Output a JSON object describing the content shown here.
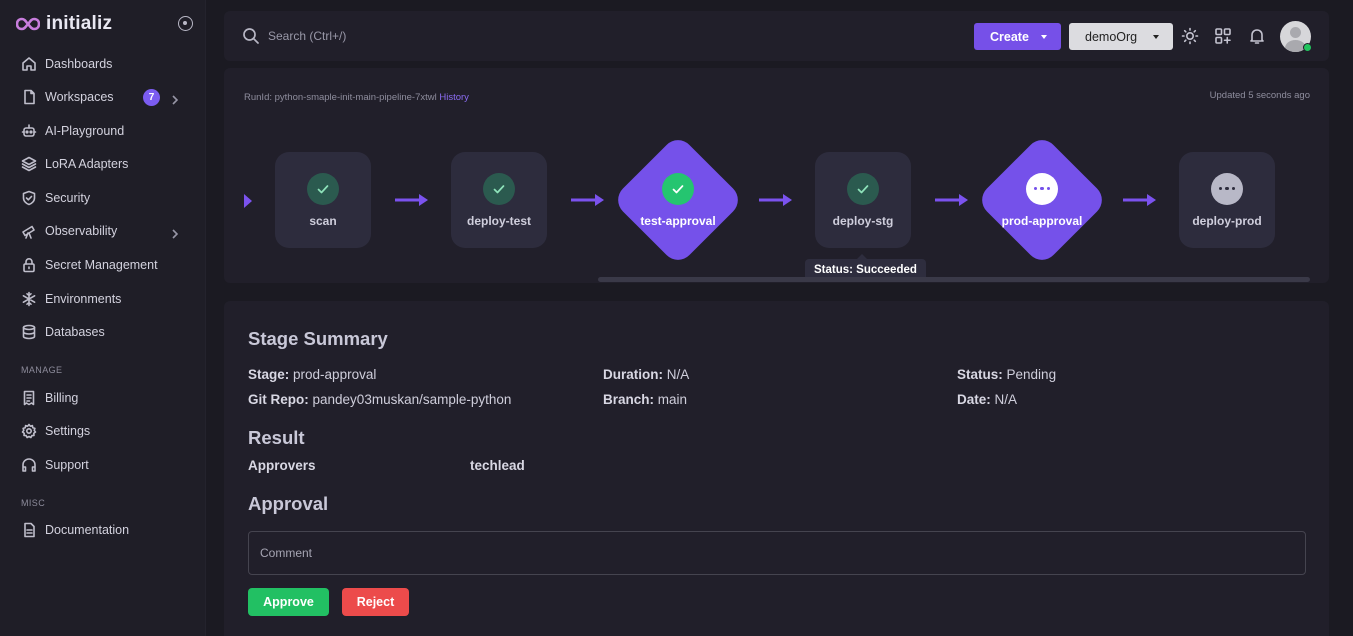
{
  "brand": {
    "name": "initializ"
  },
  "sidebar": {
    "items": [
      {
        "label": "Dashboards",
        "icon": "home-icon"
      },
      {
        "label": "Workspaces",
        "icon": "file-icon",
        "badge": "7"
      },
      {
        "label": "AI-Playground",
        "icon": "robot-icon"
      },
      {
        "label": "LoRA Adapters",
        "icon": "layers-icon"
      },
      {
        "label": "Security",
        "icon": "shield-icon"
      },
      {
        "label": "Observability",
        "icon": "telescope-icon"
      },
      {
        "label": "Secret Management",
        "icon": "lock-icon"
      },
      {
        "label": "Environments",
        "icon": "snowflake-icon"
      },
      {
        "label": "Databases",
        "icon": "database-icon"
      }
    ],
    "manage_label": "MANAGE",
    "manage_items": [
      {
        "label": "Billing",
        "icon": "receipt-icon"
      },
      {
        "label": "Settings",
        "icon": "gear-icon"
      },
      {
        "label": "Support",
        "icon": "headphones-icon"
      }
    ],
    "misc_label": "MISC",
    "misc_items": [
      {
        "label": "Documentation",
        "icon": "document-icon"
      }
    ]
  },
  "topbar": {
    "search_placeholder": "Search (Ctrl+/)",
    "create_label": "Create",
    "org_label": "demoOrg"
  },
  "pipeline": {
    "runid_prefix": "RunId: python-smaple-init-main-pipeline-7xtwl",
    "history_label": "History",
    "updated": "Updated 5 seconds ago",
    "stages": [
      {
        "name": "scan",
        "status": "succeeded",
        "type": "job"
      },
      {
        "name": "deploy-test",
        "status": "succeeded",
        "type": "job"
      },
      {
        "name": "test-approval",
        "status": "succeeded",
        "type": "approval"
      },
      {
        "name": "deploy-stg",
        "status": "succeeded",
        "type": "job"
      },
      {
        "name": "prod-approval",
        "status": "pending",
        "type": "approval"
      },
      {
        "name": "deploy-prod",
        "status": "pending",
        "type": "job"
      }
    ],
    "tooltip": "Status: Succeeded"
  },
  "summary": {
    "title": "Stage Summary",
    "stage_label": "Stage:",
    "stage_value": "prod-approval",
    "duration_label": "Duration:",
    "duration_value": "N/A",
    "status_label": "Status:",
    "status_value": "Pending",
    "repo_label": "Git Repo:",
    "repo_value": "pandey03muskan/sample-python",
    "branch_label": "Branch:",
    "branch_value": "main",
    "date_label": "Date:",
    "date_value": "N/A",
    "result_title": "Result",
    "approvers_label": "Approvers",
    "approvers_value": "techlead",
    "approval_title": "Approval",
    "comment_placeholder": "Comment",
    "approve_label": "Approve",
    "reject_label": "Reject"
  },
  "colors": {
    "accent": "#7650e8",
    "success": "#22c063",
    "danger": "#ec4b4b",
    "online": "#22c55e"
  }
}
